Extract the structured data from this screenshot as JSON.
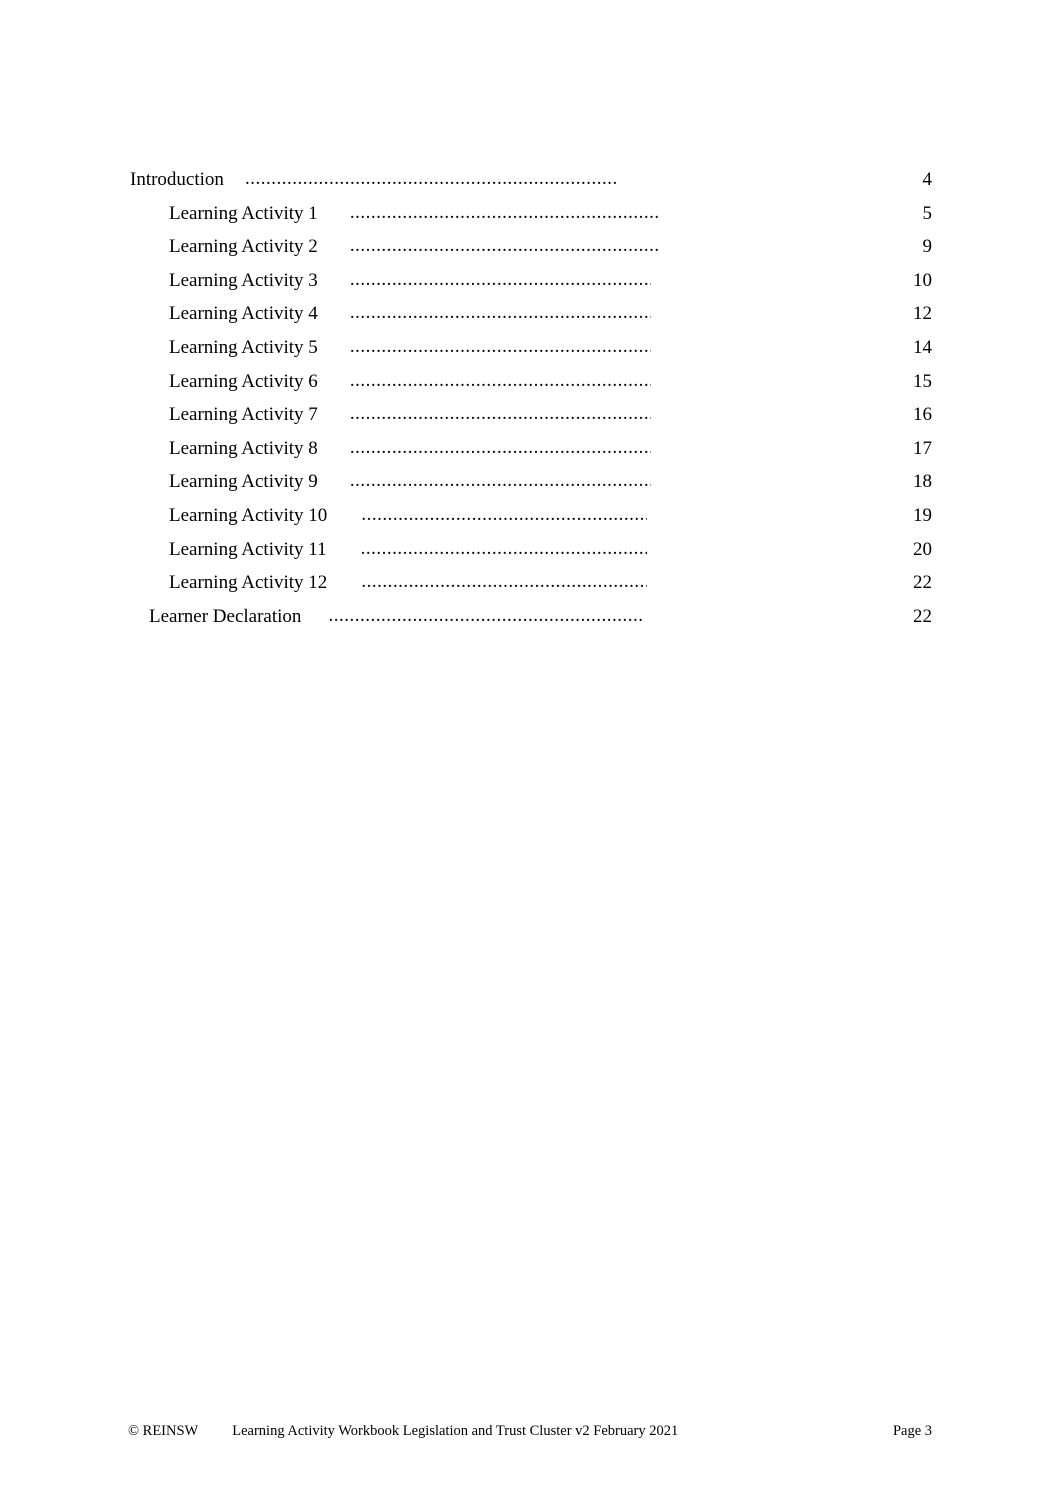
{
  "document": {
    "type": "table-of-contents",
    "page_number_label": "Page 3"
  },
  "toc": {
    "entries": [
      {
        "label": "Introduction",
        "page": "4",
        "level": 0
      },
      {
        "label": "Learning Activity 1",
        "page": "5",
        "level": 1
      },
      {
        "label": "Learning Activity 2",
        "page": "9",
        "level": 1
      },
      {
        "label": "Learning Activity 3",
        "page": "10",
        "level": 1
      },
      {
        "label": "Learning Activity 4",
        "page": "12",
        "level": 1
      },
      {
        "label": "Learning Activity 5",
        "page": "14",
        "level": 1
      },
      {
        "label": "Learning Activity 6",
        "page": "15",
        "level": 1
      },
      {
        "label": "Learning Activity 7",
        "page": "16",
        "level": 1
      },
      {
        "label": "Learning Activity 8",
        "page": "17",
        "level": 1
      },
      {
        "label": "Learning Activity 9",
        "page": "18",
        "level": 1
      },
      {
        "label": "Learning Activity 10",
        "page": "19",
        "level": 1
      },
      {
        "label": "Learning Activity 11",
        "page": "20",
        "level": 1
      },
      {
        "label": "Learning Activity 12",
        "page": "22",
        "level": 1
      },
      {
        "label": "Learner Declaration",
        "page": "22",
        "level": 0
      }
    ]
  },
  "footer": {
    "copyright": "© REINSW",
    "doc_title": "Learning Activity Workbook Legislation and Trust Cluster v2 February 2021",
    "page_label": "Page 3"
  }
}
